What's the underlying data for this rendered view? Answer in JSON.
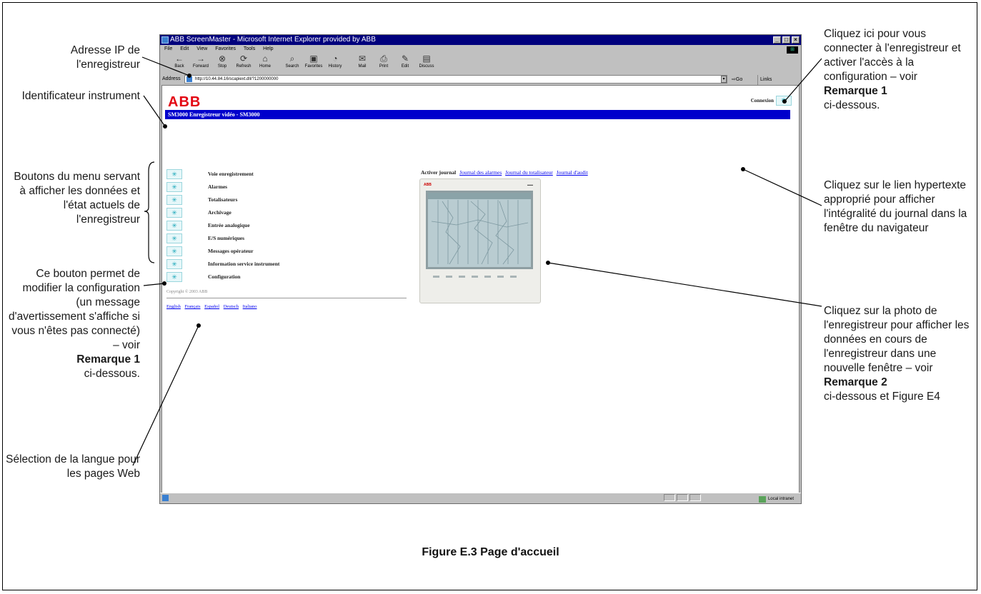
{
  "browser": {
    "title": "ABB ScreenMaster - Microsoft Internet Explorer provided by ABB",
    "menu": [
      "File",
      "Edit",
      "View",
      "Favorites",
      "Tools",
      "Help"
    ],
    "toolbar": [
      "Back",
      "Forward",
      "Stop",
      "Refresh",
      "Home",
      "Search",
      "Favorites",
      "History",
      "Mail",
      "Print",
      "Edit",
      "Discuss"
    ],
    "address_label": "Address",
    "address_value": "http://10.44.84.16/scapiext.dll/?1200000000",
    "go_label": "Go",
    "links_label": "Links",
    "status_zone": "Local intranet"
  },
  "page": {
    "logo": "ABB",
    "connexion_label": "Connexion",
    "banner": "SM3000 Enregistreur vidéo - SM3000",
    "menu_items": [
      "Voie enregistrement",
      "Alarmes",
      "Totalisateurs",
      "Archivage",
      "Entrée analogique",
      "E/S numériques",
      "Messages opérateur",
      "Information service instrument",
      "Configuration"
    ],
    "copyright": "Copyright © 2003 ABB",
    "languages": [
      "English",
      "Français",
      "Español",
      "Deutsch",
      "Italiano"
    ],
    "journal_active": "Activer journal",
    "journal_links": [
      "Journal des alarmes",
      "Journal du totalisateur",
      "Journal d'audit"
    ]
  },
  "annotations": {
    "left": [
      "Adresse IP de l'enregistreur",
      "Identificateur instrument",
      "Boutons du menu servant à afficher les données et l'état actuels de l'enregistreur",
      "Ce bouton permet de modifier la configuration (un message d'avertissement s'affiche si vous n'êtes pas connecté) – voir",
      "Remarque 1",
      "ci-dessous.",
      "Sélection de la langue pour les pages Web"
    ],
    "right": [
      "Cliquez ici pour vous connecter à l'enregistreur et activer l'accès à la configuration – voir",
      "Remarque 1",
      "ci-dessous.",
      "Cliquez sur le lien hypertexte approprié pour afficher l'intégralité du journal dans la fenêtre du navigateur",
      "Cliquez sur la photo de l'enregistreur pour afficher les données en cours de l'enregistreur dans une nouvelle fenêtre – voir",
      "Remarque 2",
      "ci-dessous et Figure E4"
    ]
  },
  "caption": "Figure E.3 Page d'accueil"
}
